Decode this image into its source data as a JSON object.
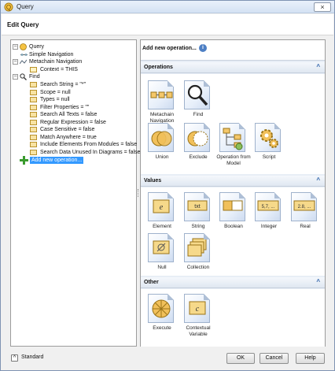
{
  "window": {
    "title": "Query",
    "close_glyph": "×"
  },
  "header": {
    "title": "Edit Query"
  },
  "tree": {
    "items": [
      {
        "label": "Query",
        "icon": "query-icon"
      },
      {
        "label": "Simple Navigation",
        "icon": "navigation-icon"
      },
      {
        "label": "Metachain Navigation",
        "icon": "metachain-icon"
      },
      {
        "label": "Context = THIS",
        "icon": "context-icon"
      },
      {
        "label": "Find",
        "icon": "find-icon"
      },
      {
        "label": "Search String = \"*\"",
        "icon": "text-property-icon"
      },
      {
        "label": "Scope = null",
        "icon": "property-icon"
      },
      {
        "label": "Types = null",
        "icon": "property-icon"
      },
      {
        "label": "Filter Properties = \"\"",
        "icon": "text-property-icon"
      },
      {
        "label": "Search All Texts = false",
        "icon": "property-icon"
      },
      {
        "label": "Regular Expression = false",
        "icon": "property-icon"
      },
      {
        "label": "Case Sensitive = false",
        "icon": "property-icon"
      },
      {
        "label": "Match Anywhere = true",
        "icon": "property-icon"
      },
      {
        "label": "Include Elements From Modules = false",
        "icon": "property-icon"
      },
      {
        "label": "Search Data Unused In Diagrams = false",
        "icon": "property-icon"
      },
      {
        "label": "Add new operation...",
        "icon": "add-icon"
      }
    ]
  },
  "right": {
    "title": "Add new operation...",
    "categories": {
      "operations": {
        "label": "Operations",
        "tools": [
          {
            "label": "Metachain Navigation",
            "icon": "metachain-navigation-icon"
          },
          {
            "label": "Find",
            "icon": "find-magnifier-icon"
          },
          {
            "label": "Union",
            "icon": "union-icon"
          },
          {
            "label": "Exclude",
            "icon": "exclude-icon"
          },
          {
            "label": "Operation from Model",
            "icon": "operation-from-model-icon"
          },
          {
            "label": "Script",
            "icon": "script-gears-icon"
          }
        ]
      },
      "values": {
        "label": "Values",
        "tools": [
          {
            "label": "Element",
            "icon": "element-value-icon",
            "glyph": "e"
          },
          {
            "label": "String",
            "icon": "string-value-icon",
            "glyph": "txt"
          },
          {
            "label": "Boolean",
            "icon": "boolean-value-icon"
          },
          {
            "label": "Integer",
            "icon": "integer-value-icon",
            "glyph": "5,7, ..."
          },
          {
            "label": "Real",
            "icon": "real-value-icon",
            "glyph": "2.8, ..."
          },
          {
            "label": "Null",
            "icon": "null-value-icon"
          },
          {
            "label": "Collection",
            "icon": "collection-value-icon"
          }
        ]
      },
      "other": {
        "label": "Other",
        "tools": [
          {
            "label": "Execute",
            "icon": "execute-icon"
          },
          {
            "label": "Contextual Variable",
            "icon": "contextual-variable-icon",
            "glyph": "c"
          }
        ]
      }
    },
    "collapse_glyph": "^"
  },
  "footer": {
    "standard_label": "Standard",
    "ok_label": "OK",
    "cancel_label": "Cancel",
    "help_label": "Help"
  }
}
